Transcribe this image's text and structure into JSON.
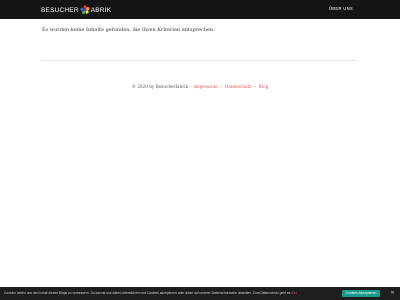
{
  "header": {
    "logo_text": "BESUCHERFABRIK",
    "nav_about": "ÜBER UNS"
  },
  "main": {
    "notice": "Es wurden keine Inhalte gefunden, die Ihren Kriterien entsprechen."
  },
  "footer": {
    "copyright": "© 2020 by Besucherfabrik –",
    "sep1": "–",
    "sep2": "–",
    "links": [
      "Impressum",
      "Datenschutz",
      "Blog"
    ]
  },
  "cookie_banner": {
    "text": "Cookies helfen uns den Inhalt dieses Blogs zu verbessern. Du kannst uns dabei unterstützen und Cookies akzeptieren oder diese auf unserer Datenschutzseite abstellen. Zum Datenschutz geht es",
    "link": "hier",
    "accept_label": "Cookies Akzeptieren",
    "close_label": "✕"
  },
  "colors": {
    "header_bg": "#151515",
    "link": "#d9534f",
    "accept_bg": "#1a9a8a"
  }
}
